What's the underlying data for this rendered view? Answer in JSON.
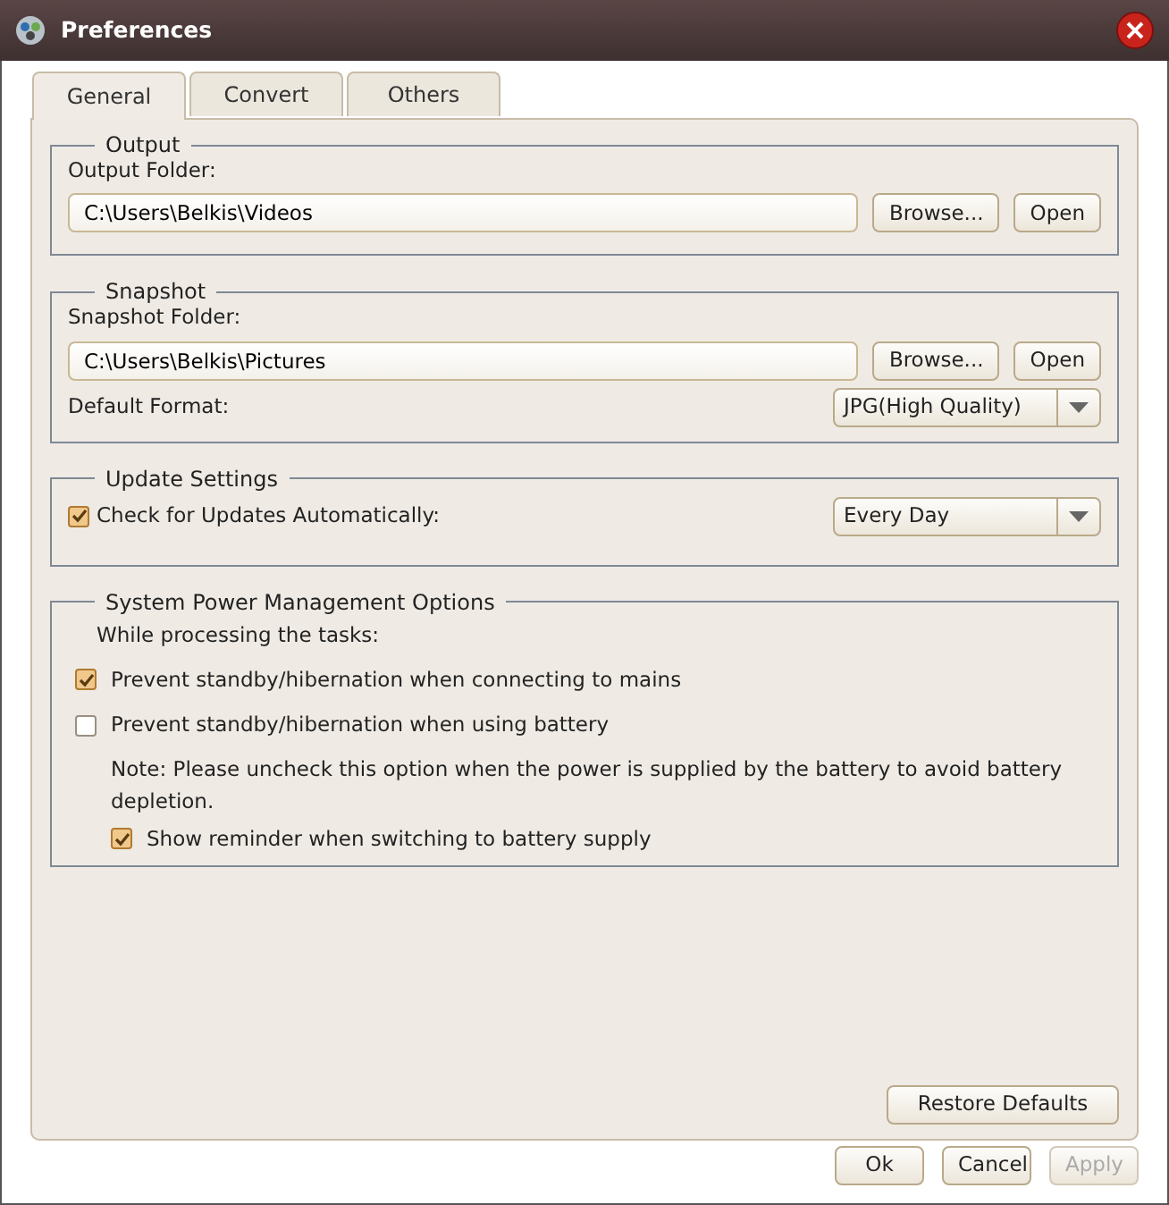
{
  "window": {
    "title": "Preferences"
  },
  "tabs": [
    {
      "label": "General",
      "selected": true
    },
    {
      "label": "Convert",
      "selected": false
    },
    {
      "label": "Others",
      "selected": false
    }
  ],
  "output": {
    "title": "Output",
    "folder_label": "Output Folder:",
    "folder_value": "C:\\Users\\Belkis\\Videos",
    "buttons": [
      "Browse...",
      "Open"
    ]
  },
  "snapshot": {
    "title": "Snapshot",
    "folder_label": "Snapshot Folder:",
    "folder_value": "C:\\Users\\Belkis\\Pictures",
    "buttons": [
      "Browse...",
      "Open"
    ],
    "format_label": "Default Format:",
    "format_value": "JPG(High Quality)"
  },
  "update": {
    "title": "Update Settings",
    "check": {
      "label": "Check for Updates Automatically:",
      "checked": true
    },
    "frequency": "Every Day"
  },
  "power": {
    "title": "System Power Management Options",
    "intro": "While processing the tasks:",
    "options": [
      {
        "label": "Prevent standby/hibernation when connecting to mains",
        "checked": true
      },
      {
        "label": "Prevent standby/hibernation when using battery",
        "checked": false
      }
    ],
    "note": "Note: Please uncheck this option when the power is supplied by the battery to avoid battery depletion.",
    "reminder": {
      "label": "Show reminder when switching to battery supply",
      "checked": true
    }
  },
  "restore_button": "Restore Defaults",
  "footer_buttons": [
    {
      "label": "Ok",
      "disabled": false
    },
    {
      "label": "Cancel",
      "disabled": false
    },
    {
      "label": "Apply",
      "disabled": true
    }
  ]
}
